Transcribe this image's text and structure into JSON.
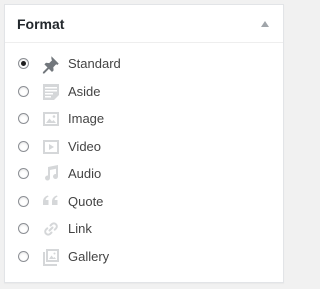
{
  "panel": {
    "title": "Format",
    "toggle_icon": "arrow-up-icon"
  },
  "formats": [
    {
      "label": "Standard",
      "icon": "pin-icon",
      "checked": true
    },
    {
      "label": "Aside",
      "icon": "aside-icon",
      "checked": false
    },
    {
      "label": "Image",
      "icon": "image-icon",
      "checked": false
    },
    {
      "label": "Video",
      "icon": "video-icon",
      "checked": false
    },
    {
      "label": "Audio",
      "icon": "audio-icon",
      "checked": false
    },
    {
      "label": "Quote",
      "icon": "quote-icon",
      "checked": false
    },
    {
      "label": "Link",
      "icon": "link-icon",
      "checked": false
    },
    {
      "label": "Gallery",
      "icon": "gallery-icon",
      "checked": false
    }
  ],
  "colors": {
    "icon_active": "#72777c",
    "icon_inactive": "#d5d7d9",
    "text": "#444444",
    "title": "#23282d"
  }
}
